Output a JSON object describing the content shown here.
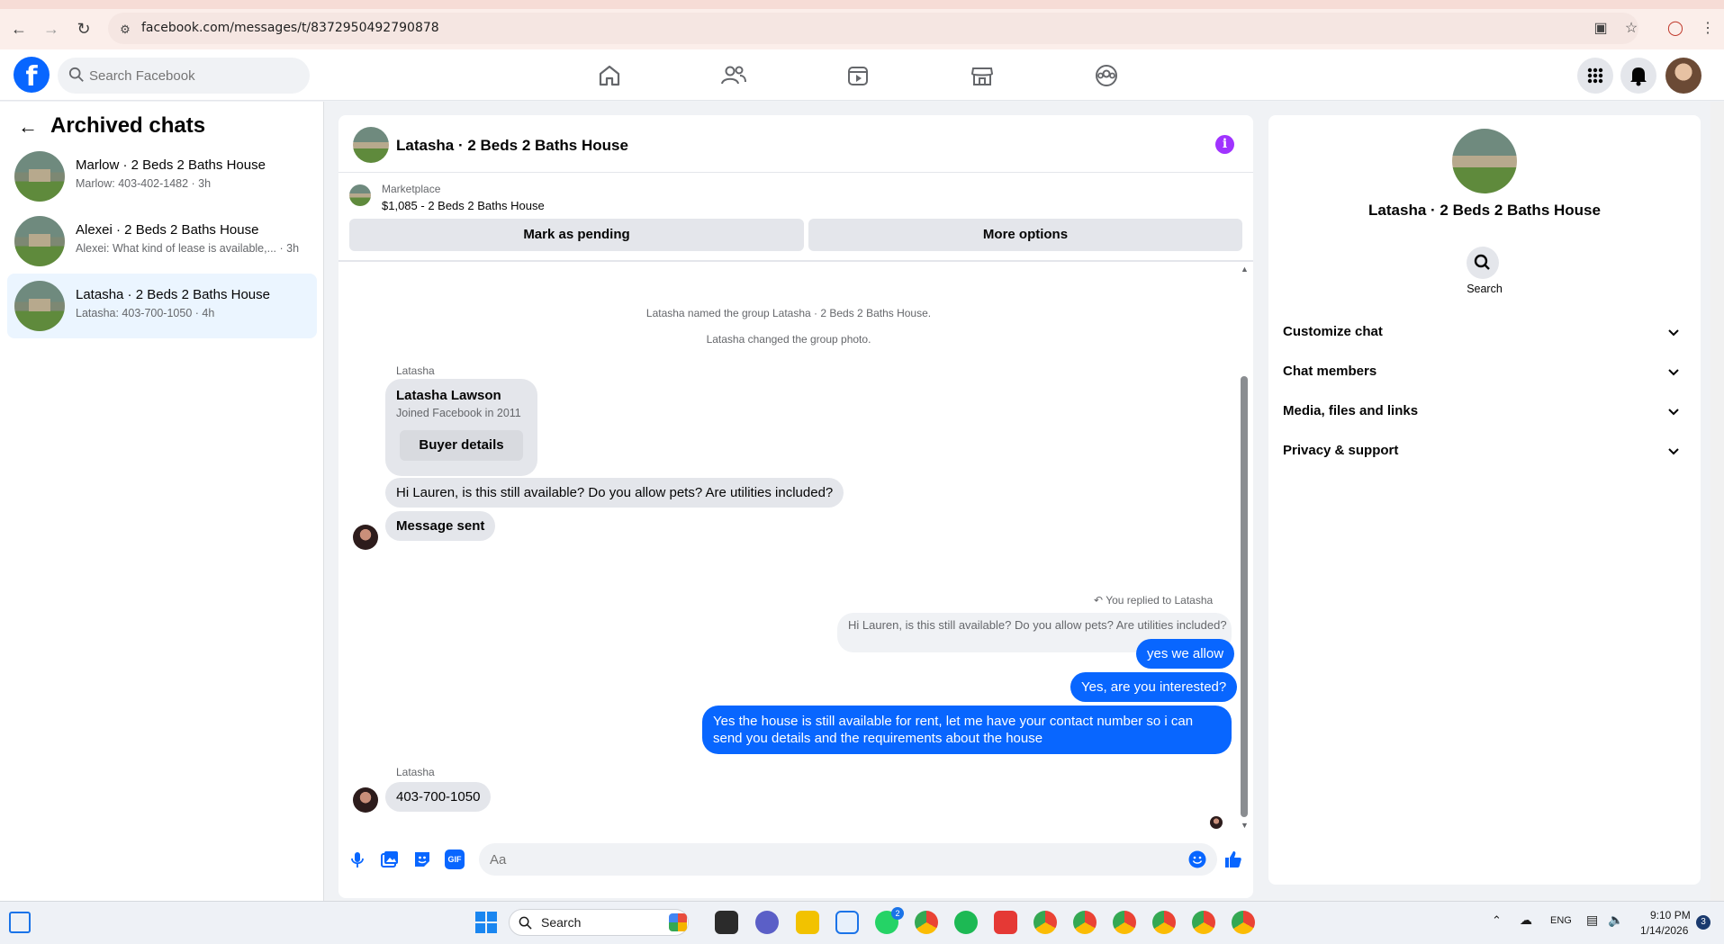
{
  "browser": {
    "url": "facebook.com/messages/t/8372950492790878"
  },
  "fb_header": {
    "search_placeholder": "Search Facebook"
  },
  "sidebar": {
    "title": "Archived chats",
    "chats": [
      {
        "name": "Marlow · 2 Beds 2 Baths House",
        "preview": "Marlow: 403-402-1482 · 3h",
        "active": false
      },
      {
        "name": "Alexei · 2 Beds 2 Baths House",
        "preview": "Alexei: What kind of lease is available,... · 3h",
        "active": false
      },
      {
        "name": "Latasha · 2 Beds 2 Baths House",
        "preview": "Latasha: 403-700-1050 · 4h",
        "active": true
      }
    ]
  },
  "conversation": {
    "title": "Latasha · 2 Beds 2 Baths House",
    "marketplace_label": "Marketplace",
    "listing": "$1,085 - 2 Beds 2 Baths House",
    "mark_pending_label": "Mark as pending",
    "more_options_label": "More options",
    "system_messages": [
      "Latasha named the group Latasha · 2 Beds 2 Baths House.",
      "Latasha changed the group photo."
    ],
    "sender_name": "Latasha",
    "buyer_card": {
      "name": "Latasha Lawson",
      "joined": "Joined Facebook in 2011",
      "button": "Buyer details"
    },
    "incoming_1": "Hi Lauren, is this still available? Do you allow pets? Are utilities included?",
    "incoming_2": "Message sent",
    "reply_note": "You replied to Latasha",
    "quoted": "Hi Lauren, is this still available? Do you allow pets? Are utilities included?",
    "outgoing": [
      "yes we allow",
      "Yes, are you interested?",
      "Yes the house is still available for rent, let me have your contact number so i can send you details and the requirements about the house"
    ],
    "sender_name_2": "Latasha",
    "incoming_3": "403-700-1050",
    "composer_placeholder": "Aa"
  },
  "right_panel": {
    "title": "Latasha · 2 Beds 2 Baths House",
    "search_label": "Search",
    "sections": [
      "Customize chat",
      "Chat members",
      "Media, files and links",
      "Privacy & support"
    ]
  },
  "taskbar": {
    "search_label": "Search",
    "time": "9:10 PM",
    "date": "1/14/2026",
    "language": "ENG",
    "whatsapp_badge": "2",
    "notification_count": "3"
  },
  "colors": {
    "fb_blue": "#0866ff",
    "info_purple": "#a033ff",
    "active_chat_bg": "#ebf5ff"
  }
}
